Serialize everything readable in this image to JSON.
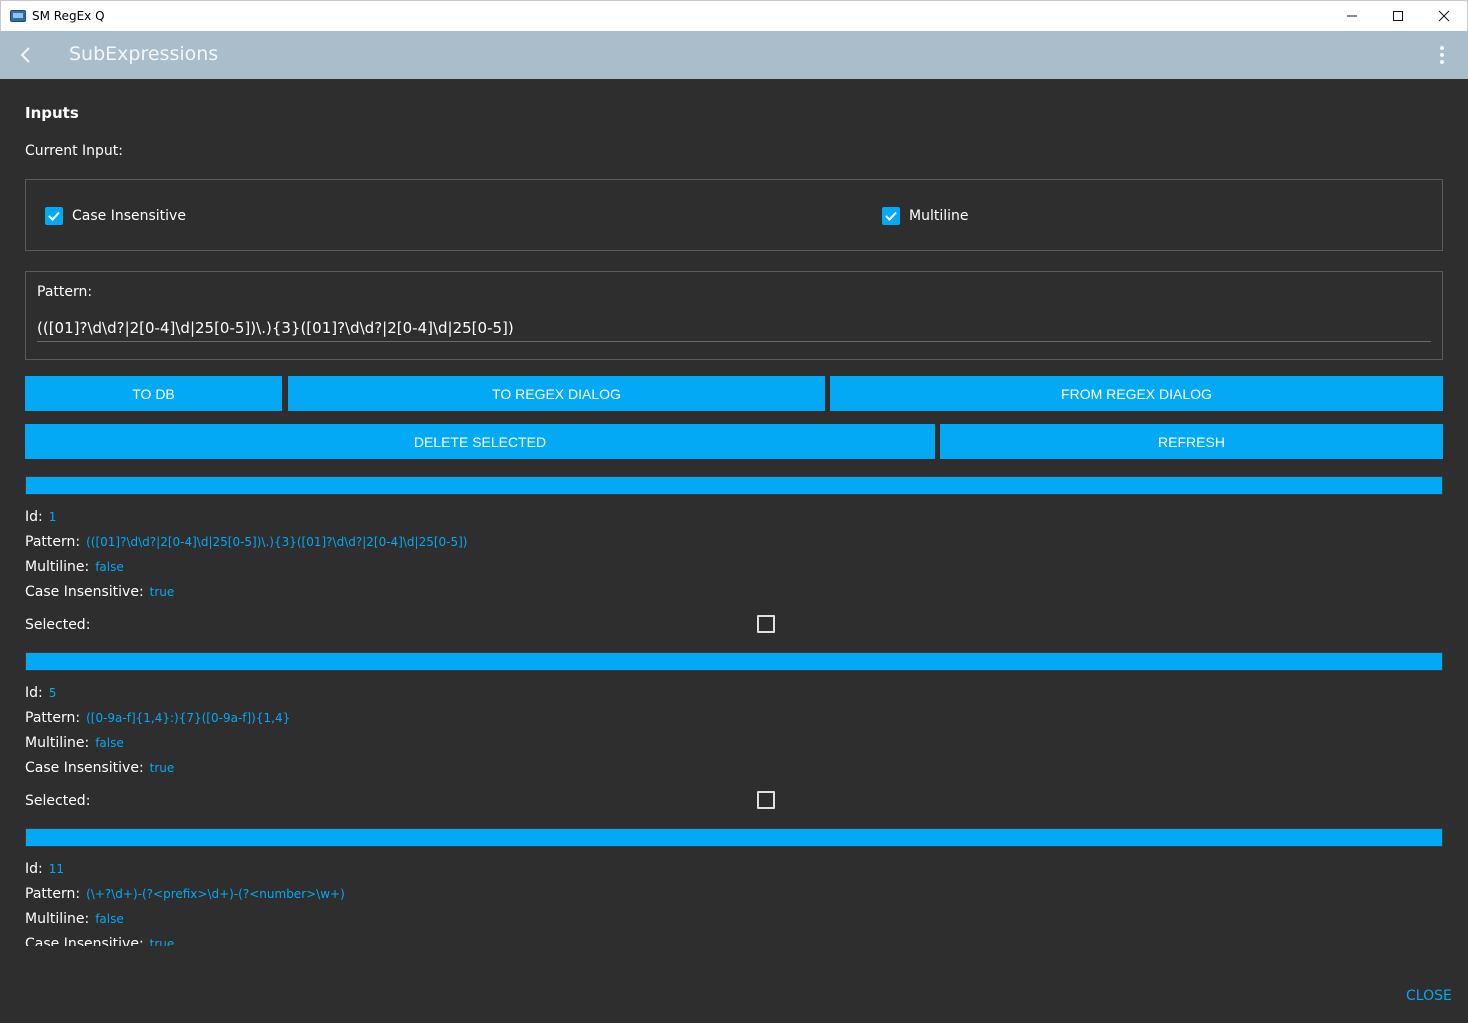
{
  "window": {
    "title": "SM RegEx Q",
    "minimize": "—",
    "maximize": "☐",
    "close": "✕"
  },
  "appbar": {
    "title": "SubExpressions"
  },
  "inputs": {
    "heading": "Inputs",
    "current_label": "Current Input:",
    "case_insensitive_label": "Case Insensitive",
    "multiline_label": "Multiline",
    "pattern_label": "Pattern:",
    "pattern_value": "(([01]?\\d\\d?|2[0-4]\\d|25[0-5])\\.){3}([01]?\\d\\d?|2[0-4]\\d|25[0-5])"
  },
  "buttons": {
    "to_db": "TO DB",
    "to_regex_dialog": "TO REGEX DIALOG",
    "from_regex_dialog": "FROM REGEX DIALOG",
    "delete_selected": "DELETE SELECTED",
    "refresh": "REFRESH"
  },
  "labels": {
    "id": "Id:",
    "pattern": "Pattern:",
    "multiline": "Multiline:",
    "case_insensitive": "Case Insensitive:",
    "selected": "Selected:"
  },
  "records": [
    {
      "id": "1",
      "pattern": "(([01]?\\d\\d?|2[0-4]\\d|25[0-5])\\.){3}([01]?\\d\\d?|2[0-4]\\d|25[0-5])",
      "multiline": "false",
      "case_insensitive": "true"
    },
    {
      "id": "5",
      "pattern": "([0-9a-f]{1,4}:){7}([0-9a-f]){1,4}",
      "multiline": "false",
      "case_insensitive": "true"
    },
    {
      "id": "11",
      "pattern": "(\\+?\\d+)-(?<prefix>\\d+)-(?<number>\\w+)",
      "multiline": "false",
      "case_insensitive": "true"
    }
  ],
  "footer": {
    "close_label": "CLOSE"
  },
  "colors": {
    "accent": "#03a9f4",
    "background": "#2e2e2e",
    "appbar": "#a9bdca"
  }
}
